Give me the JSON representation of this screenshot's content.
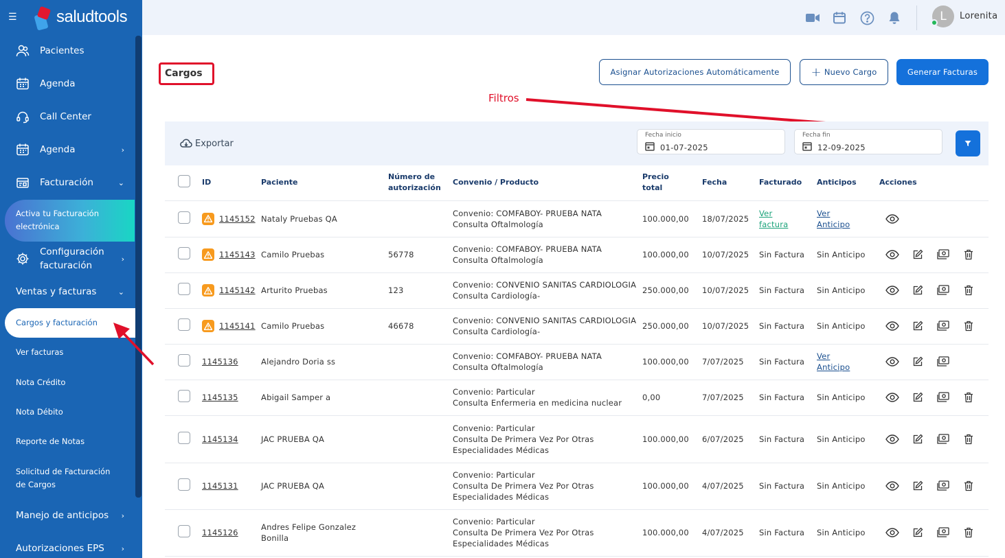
{
  "app": {
    "brand": "saludtools"
  },
  "sidebar": {
    "main": [
      {
        "label": "Pacientes",
        "icon": "users-icon"
      },
      {
        "label": "Agenda",
        "icon": "calendar-icon"
      },
      {
        "label": "Call Center",
        "icon": "headset-icon"
      },
      {
        "label": "Agenda",
        "icon": "calendar-icon"
      },
      {
        "label": "Facturación",
        "icon": "invoice-icon"
      }
    ],
    "activate_line1": "Activa tu Facturación",
    "activate_line2": "electrónica",
    "config_line1": "Configuración",
    "config_line2": "facturación",
    "ventas": "Ventas y facturas",
    "subitems": [
      "Cargos y facturación",
      "Ver facturas",
      "Nota Crédito",
      "Nota Débito",
      "Reporte de Notas"
    ],
    "solicitud_line1": "Solicitud de Facturación",
    "solicitud_line2": "de Cargos",
    "anticipos": "Manejo de anticipos",
    "autorizaciones": "Autorizaciones EPS"
  },
  "topbar": {
    "user_initial": "L",
    "user_name": "Lorenita",
    "icons": [
      "video-icon",
      "calendar-icon",
      "help-icon",
      "bell-icon"
    ]
  },
  "page": {
    "title": "Cargos",
    "annotation": "Filtros"
  },
  "actions": {
    "assign": "Asignar Autorizaciones Automáticamente",
    "new_charge": "Nuevo Cargo",
    "generate": "Generar Facturas"
  },
  "toolbar": {
    "export": "Exportar",
    "start_label": "Fecha inicio",
    "start_value": "01-07-2025",
    "end_label": "Fecha fin",
    "end_value": "12-09-2025"
  },
  "table": {
    "headers": {
      "id": "ID",
      "patient": "Paciente",
      "auth_1": "Número de",
      "auth_2": "autorización",
      "conv": "Convenio / Producto",
      "price_1": "Precio",
      "price_2": "total",
      "date": "Fecha",
      "billed": "Facturado",
      "advances": "Anticipos",
      "actions": "Acciones"
    },
    "rows": [
      {
        "warn": true,
        "id": "1145152",
        "patient": [
          "Nataly Pruebas QA"
        ],
        "auth": "",
        "conv": [
          "Convenio: COMFABOY- PRUEBA NATA",
          "Consulta Oftalmología"
        ],
        "price": "100.000,00",
        "date": "18/07/2025",
        "billed": [
          "Ver",
          "factura"
        ],
        "billed_link": true,
        "adv": [
          "Ver",
          "Anticipo"
        ],
        "adv_link": true,
        "edit": false,
        "del": false
      },
      {
        "warn": true,
        "id": "1145143",
        "patient": [
          "Camilo Pruebas"
        ],
        "auth": "56778",
        "conv": [
          "Convenio: COMFABOY- PRUEBA NATA",
          "Consulta Oftalmología"
        ],
        "price": "100.000,00",
        "date": "10/07/2025",
        "billed": [
          "Sin Factura"
        ],
        "billed_link": false,
        "adv": [
          "Sin Anticipo"
        ],
        "adv_link": false,
        "edit": true,
        "del": true
      },
      {
        "warn": true,
        "id": "1145142",
        "patient": [
          "Arturito Pruebas"
        ],
        "auth": "123",
        "conv": [
          "Convenio: CONVENIO SANITAS CARDIOLOGIA",
          "Consulta Cardiología-"
        ],
        "price": "250.000,00",
        "date": "10/07/2025",
        "billed": [
          "Sin Factura"
        ],
        "billed_link": false,
        "adv": [
          "Sin Anticipo"
        ],
        "adv_link": false,
        "edit": true,
        "del": true
      },
      {
        "warn": true,
        "id": "1145141",
        "patient": [
          "Camilo Pruebas"
        ],
        "auth": "46678",
        "conv": [
          "Convenio: CONVENIO SANITAS CARDIOLOGIA",
          "Consulta Cardiología-"
        ],
        "price": "250.000,00",
        "date": "10/07/2025",
        "billed": [
          "Sin Factura"
        ],
        "billed_link": false,
        "adv": [
          "Sin Anticipo"
        ],
        "adv_link": false,
        "edit": true,
        "del": true
      },
      {
        "warn": false,
        "id": "1145136",
        "patient": [
          "Alejandro Doria ss"
        ],
        "auth": "",
        "conv": [
          "Convenio: COMFABOY- PRUEBA NATA",
          "Consulta Oftalmología"
        ],
        "price": "100.000,00",
        "date": "7/07/2025",
        "billed": [
          "Sin Factura"
        ],
        "billed_link": false,
        "adv": [
          "Ver",
          "Anticipo"
        ],
        "adv_link": true,
        "edit": true,
        "del": false
      },
      {
        "warn": false,
        "id": "1145135",
        "patient": [
          "Abigail Samper a"
        ],
        "auth": "",
        "conv": [
          "Convenio: Particular",
          "Consulta Enfermeria en medicina nuclear"
        ],
        "price": "0,00",
        "date": "7/07/2025",
        "billed": [
          "Sin Factura"
        ],
        "billed_link": false,
        "adv": [
          "Sin Anticipo"
        ],
        "adv_link": false,
        "edit": true,
        "del": true
      },
      {
        "warn": false,
        "id": "1145134",
        "patient": [
          "JAC PRUEBA QA"
        ],
        "auth": "",
        "conv": [
          "Convenio: Particular",
          "Consulta De Primera Vez Por Otras",
          "Especialidades Médicas"
        ],
        "price": "100.000,00",
        "date": "6/07/2025",
        "billed": [
          "Sin Factura"
        ],
        "billed_link": false,
        "adv": [
          "Sin Anticipo"
        ],
        "adv_link": false,
        "edit": true,
        "del": true
      },
      {
        "warn": false,
        "id": "1145131",
        "patient": [
          "JAC PRUEBA QA"
        ],
        "auth": "",
        "conv": [
          "Convenio: Particular",
          "Consulta De Primera Vez Por Otras",
          "Especialidades Médicas"
        ],
        "price": "100.000,00",
        "date": "4/07/2025",
        "billed": [
          "Sin Factura"
        ],
        "billed_link": false,
        "adv": [
          "Sin Anticipo"
        ],
        "adv_link": false,
        "edit": true,
        "del": true
      },
      {
        "warn": false,
        "id": "1145126",
        "patient": [
          "Andres Felipe Gonzalez",
          "Bonilla"
        ],
        "auth": "",
        "conv": [
          "Convenio: Particular",
          "Consulta De Primera Vez Por Otras",
          "Especialidades Médicas"
        ],
        "price": "100.000,00",
        "date": "4/07/2025",
        "billed": [
          "Sin Factura"
        ],
        "billed_link": false,
        "adv": [
          "Sin Anticipo"
        ],
        "adv_link": false,
        "edit": true,
        "del": true
      }
    ]
  },
  "colors": {
    "sidebar": "#1a65b4",
    "primary": "#1471db",
    "annotation": "#e0102a",
    "warning": "#f79a1e"
  }
}
